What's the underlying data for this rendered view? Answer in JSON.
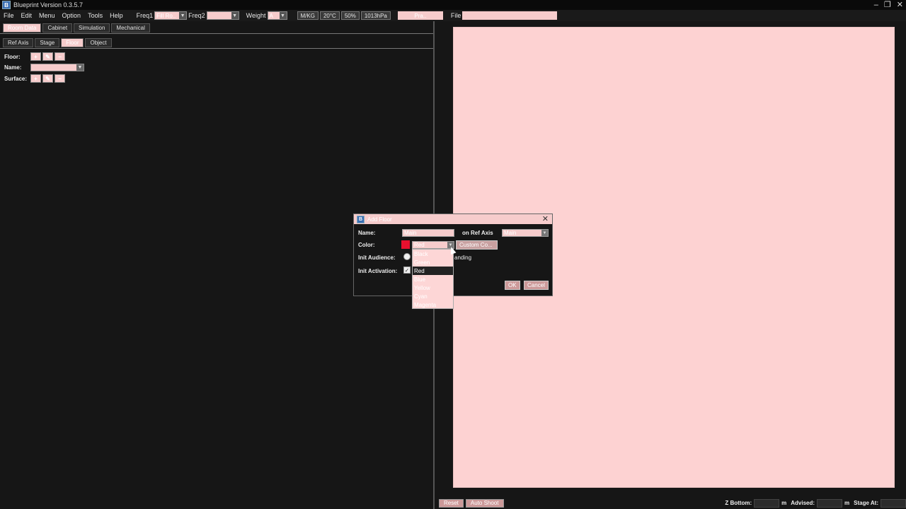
{
  "window": {
    "title": "Blueprint Version 0.3.5.7",
    "app_icon": "B",
    "controls": [
      "–",
      "❐",
      "✕"
    ]
  },
  "menu": {
    "items": [
      "File",
      "Edit",
      "Menu",
      "Option",
      "Tools",
      "Help"
    ],
    "freq1_label": "Freq1",
    "freq1_value": "Fill Ro..",
    "freq2_label": "Freq2",
    "weight_label": "Weight",
    "weight_value": "A",
    "units": [
      "M/KG",
      "20°C",
      "50%",
      "1013hPa"
    ],
    "field_value": "Pra..",
    "file_label": "File"
  },
  "left": {
    "tabs_top": [
      "Room Data",
      "Cabinet",
      "Simulation",
      "Mechanical"
    ],
    "tabs_sub": [
      "Ref Axis",
      "Stage",
      "Floor",
      "Object"
    ],
    "floor_label": "Floor:",
    "name_label": "Name:",
    "surface_label": "Surface:",
    "floor_buttons": [
      "+",
      "✎",
      "−"
    ],
    "surface_buttons": [
      "+",
      "✎",
      "−"
    ]
  },
  "bottom": {
    "reset": "Reset",
    "auto_shoot": "Auto Shoot",
    "z_bottom_label": "Z Bottom:",
    "m1": "m",
    "advised_label": "Advised:",
    "m2": "m",
    "stage_at_label": "Stage At:"
  },
  "dialog": {
    "title": "Add Floor",
    "name_label": "Name:",
    "name_value": "Main",
    "ref_axis_label": "on Ref Axis",
    "ref_axis_value": "Main",
    "color_label": "Color:",
    "color_value": "Red",
    "custom_color_btn": "Custom Co...",
    "init_audience_label": "Init Audience:",
    "standing_text": "anding",
    "init_activation_label": "Init Activation:",
    "ok": "OK",
    "cancel": "Cancel",
    "color_options": [
      "Black",
      "Green",
      "Red",
      "Blue",
      "Yellow",
      "Cyan",
      "Magenta"
    ],
    "selected_index": 2,
    "swatch_color": "#e8102e"
  }
}
